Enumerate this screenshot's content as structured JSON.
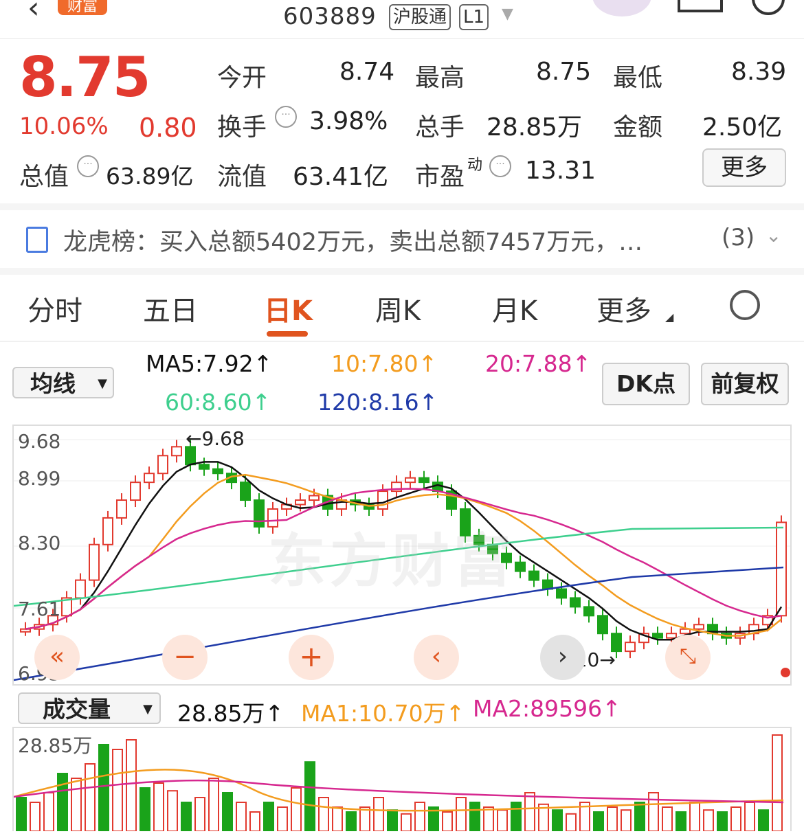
{
  "topbar": {
    "code": "603889",
    "market_tag": "沪股通",
    "level_tag": "L1",
    "logo_text": "财富"
  },
  "quote": {
    "price": "8.75",
    "change_pct": "10.06%",
    "change": "0.80",
    "market_cap_label": "总值",
    "market_cap": "63.89亿",
    "open_label": "今开",
    "open": "8.74",
    "high_label": "最高",
    "high": "8.75",
    "low_label": "最低",
    "low": "8.39",
    "turnover_label": "换手",
    "turnover": "3.98%",
    "volume_label": "总手",
    "volume": "28.85万",
    "amount_label": "金额",
    "amount": "2.50亿",
    "float_cap_label": "流值",
    "float_cap": "63.41亿",
    "pe_label": "市盈",
    "pe_sup": "动",
    "pe": "13.31",
    "more_label": "更多"
  },
  "notice": {
    "text": "龙虎榜：买入总额5402万元，卖出总额7457万元，…",
    "count": "(3)"
  },
  "tabs": [
    {
      "label": "分时"
    },
    {
      "label": "五日"
    },
    {
      "label": "日K"
    },
    {
      "label": "周K"
    },
    {
      "label": "月K"
    },
    {
      "label": "更多"
    }
  ],
  "ma_bar": {
    "selector": "均线",
    "ma5": "MA5:7.92↑",
    "ma10": "10:7.80↑",
    "ma20": "20:7.88↑",
    "ma60": "60:8.60↑",
    "ma120": "120:8.16↑",
    "dk_label": "DK点",
    "adjust_label": "前复权"
  },
  "chart": {
    "y_labels": [
      "9.68",
      "8.99",
      "8.30",
      "7.61",
      "6.93"
    ],
    "high_annotation": "←9.68",
    "low_annotation": "7.20→",
    "watermark": "东方财富"
  },
  "volume_bar": {
    "selector": "成交量",
    "value": "28.85万↑",
    "ma1": "MA1:10.70万↑",
    "ma2": "MA2:89596↑",
    "axis_label": "28.85万"
  },
  "colors": {
    "up": "#e23a2f",
    "down": "#1aa31a",
    "ma5": "#111111",
    "ma10": "#f39c1f",
    "ma20": "#d6288f",
    "ma60": "#3ecf8e",
    "ma120": "#1f3aa8",
    "accent": "#e0541f"
  }
}
